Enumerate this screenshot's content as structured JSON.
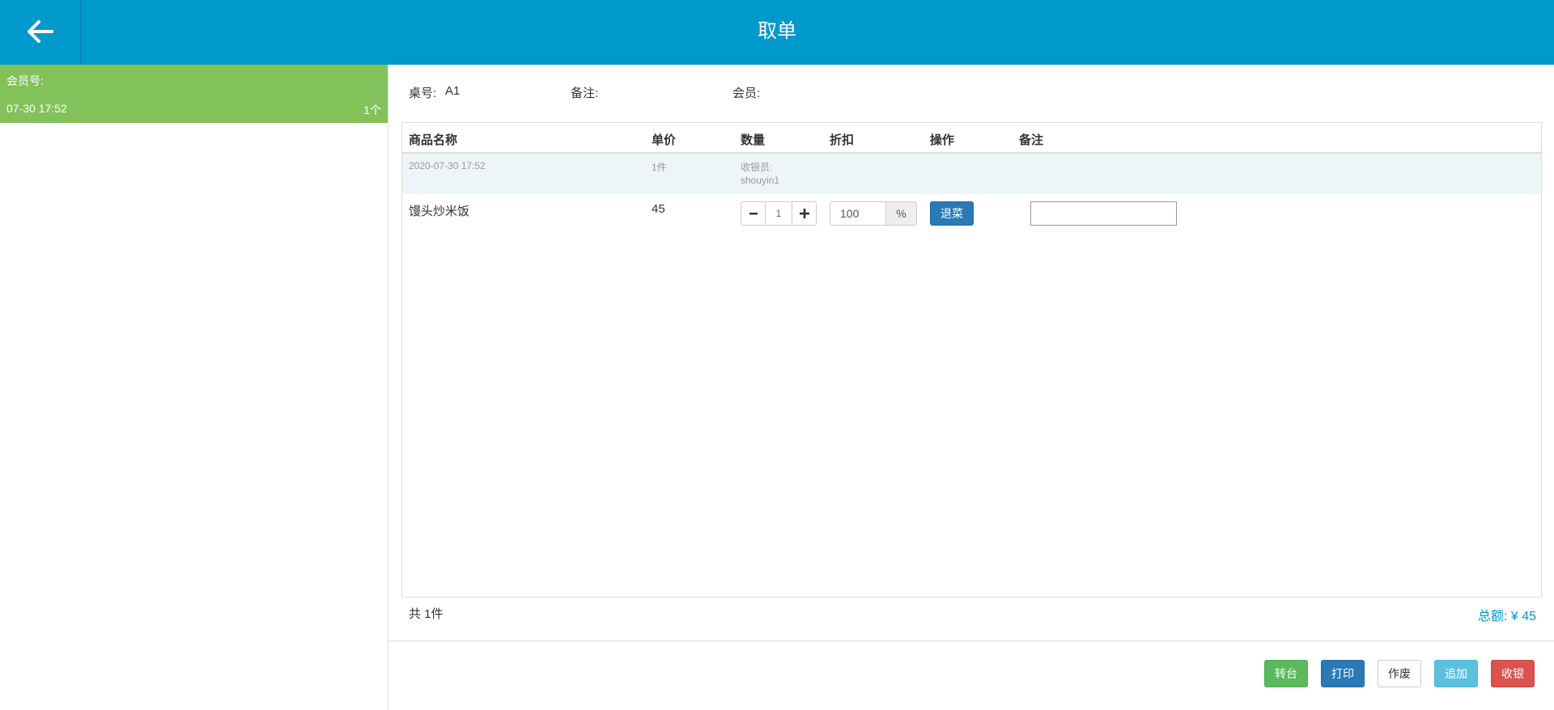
{
  "header": {
    "title": "取单",
    "back_icon": "arrow-left-icon"
  },
  "sidebar": {
    "orders": [
      {
        "member_label": "会员号:",
        "time": "07-30 17:52",
        "count": "1个",
        "color": "#83c25a"
      }
    ]
  },
  "info": {
    "table_label": "桌号:",
    "table_value": "A1",
    "remark_label": "备注:",
    "member_label": "会员:"
  },
  "table": {
    "headers": [
      "商品名称",
      "单价",
      "数量",
      "折扣",
      "操作",
      "备注"
    ],
    "meta": {
      "datetime": "2020-07-30 17:52",
      "qty": "1件",
      "cashier_label": "收银员:",
      "cashier": "shouyin1"
    },
    "items": [
      {
        "name": "馒头炒米饭",
        "price": "45",
        "quantity": "1",
        "discount": "100",
        "discount_unit": "%",
        "refund_label": "退菜",
        "remark": ""
      }
    ]
  },
  "summary": {
    "count_text": "共 1件",
    "total_text": "总额: ¥ 45"
  },
  "actions": {
    "transfer": "转台",
    "print": "打印",
    "void": "作废",
    "add": "追加",
    "checkout": "收银"
  },
  "colors": {
    "header": "#0099cc",
    "order_card": "#83c25a",
    "accent": "#0099cc"
  }
}
